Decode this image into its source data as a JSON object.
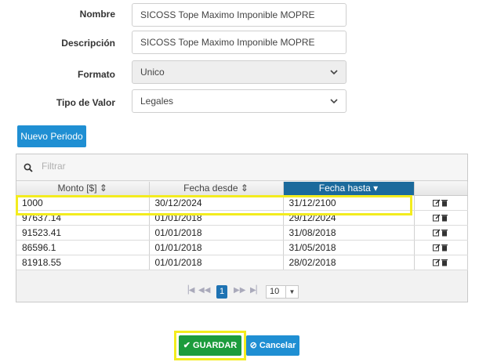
{
  "form": {
    "nombre_label": "Nombre",
    "nombre_value": "SICOSS Tope Maximo Imponible MOPRE",
    "descripcion_label": "Descripción",
    "descripcion_value": "SICOSS Tope Maximo Imponible MOPRE",
    "formato_label": "Formato",
    "formato_value": "Unico",
    "tipo_label": "Tipo de Valor",
    "tipo_value": "Legales"
  },
  "nuevo_periodo_label": "Nuevo Periodo",
  "grid": {
    "filter_placeholder": "Filtrar",
    "columns": [
      "Monto [$] ⇕",
      "Fecha desde ⇕",
      "Fecha hasta ▾"
    ],
    "sort_icons": [
      "⬍",
      "⬍",
      "▾"
    ],
    "rows": [
      {
        "monto": "1000",
        "desde": "30/12/2024",
        "hasta": "31/12/2100"
      },
      {
        "monto": "97637.14",
        "desde": "01/01/2018",
        "hasta": "29/12/2024"
      },
      {
        "monto": "91523.41",
        "desde": "01/01/2018",
        "hasta": "31/08/2018"
      },
      {
        "monto": "86596.1",
        "desde": "01/01/2018",
        "hasta": "31/05/2018"
      },
      {
        "monto": "81918.55",
        "desde": "01/01/2018",
        "hasta": "28/02/2018"
      }
    ],
    "pager": {
      "current_page": "1",
      "page_size": "10"
    }
  },
  "buttons": {
    "guardar": "✔ GUARDAR",
    "cancelar": "⊘ Cancelar"
  },
  "colors": {
    "primary": "#1f8fd3",
    "success": "#1c9c3c",
    "highlight": "#f3ec1e",
    "sorted_header": "#1b6a9c"
  }
}
